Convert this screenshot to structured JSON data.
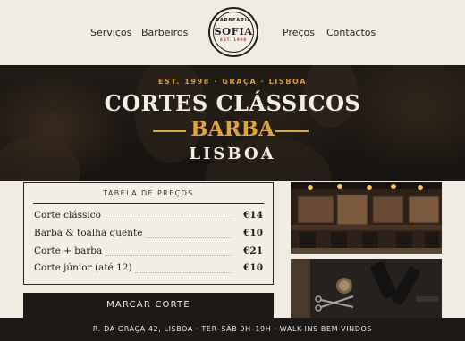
{
  "nav": {
    "left": [
      "Serviços",
      "Barbeiros"
    ],
    "right": [
      "Preços",
      "Contactos"
    ]
  },
  "logo": {
    "top": "BARBEARIA",
    "name": "SOFIA",
    "est": "EST. 1998"
  },
  "hero": {
    "tagline": "EST. 1998 · GRAÇA · LISBOA",
    "title": "CORTES CLÁSSICOS",
    "subtitle": "BARBA",
    "city": "LISBOA"
  },
  "prices": {
    "heading": "TABELA DE PREÇOS",
    "items": [
      {
        "name": "Corte clássico",
        "price": "€14"
      },
      {
        "name": "Barba & toalha quente",
        "price": "€10"
      },
      {
        "name": "Corte + barba",
        "price": "€21"
      },
      {
        "name": "Corte júnior (até 12)",
        "price": "€10"
      }
    ]
  },
  "cta": {
    "label": "MARCAR CORTE"
  },
  "footer": {
    "text": "R. DA GRAÇA 42, LISBOA  ·  TER–SÁB 9H–19H  ·  WALK-INS BEM-VINDOS"
  },
  "colors": {
    "accent": "#e0a43a",
    "dark": "#1c1916",
    "background": "#f1ece2",
    "logo_red": "#c24a2c"
  }
}
